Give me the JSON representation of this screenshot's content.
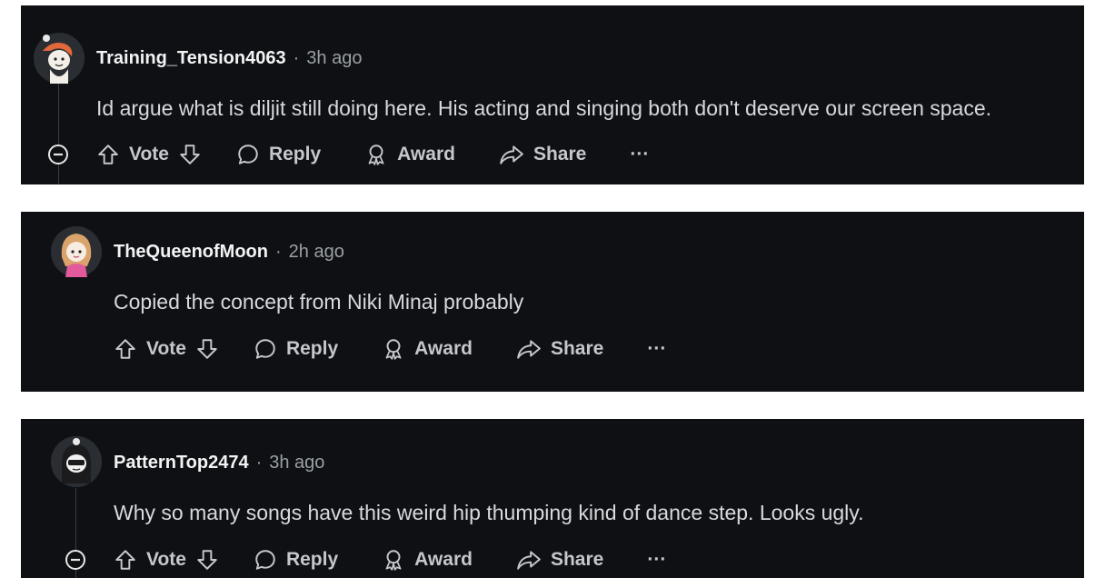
{
  "actions": {
    "vote": "Vote",
    "reply": "Reply",
    "award": "Award",
    "share": "Share",
    "more": "···"
  },
  "comments": [
    {
      "username": "Training_Tension4063",
      "separator": "·",
      "time": "3h ago",
      "text": "Id argue what is diljit still doing here. His acting and singing both don't deserve our screen space."
    },
    {
      "username": "TheQueenofMoon",
      "separator": "·",
      "time": "2h ago",
      "text": "Copied the concept from Niki Minaj probably"
    },
    {
      "username": "PatternTop2474",
      "separator": "·",
      "time": "3h ago",
      "text": "Why so many songs have this weird hip thumping kind of dance step. Looks ugly."
    }
  ],
  "colors": {
    "panel_bg": "#0e1013",
    "text_primary": "#f2f3f5",
    "text_secondary": "#9aa0a6",
    "action": "#c4c7cb"
  }
}
